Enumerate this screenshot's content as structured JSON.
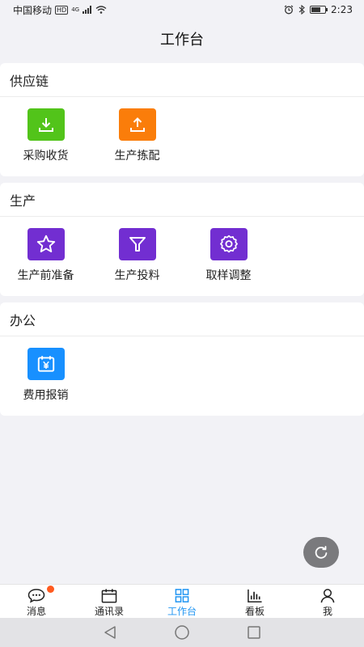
{
  "status_bar": {
    "carrier": "中国移动",
    "hd": "HD",
    "network": "4G",
    "time": "2:23",
    "battery_level": 0.7
  },
  "header": {
    "title": "工作台"
  },
  "sections": [
    {
      "title": "供应链",
      "items": [
        {
          "label": "采购收货",
          "icon": "download-icon",
          "color": "#52c41a"
        },
        {
          "label": "生产拣配",
          "icon": "upload-icon",
          "color": "#fa7d0a"
        }
      ]
    },
    {
      "title": "生产",
      "items": [
        {
          "label": "生产前准备",
          "icon": "star-icon",
          "color": "#722ed1"
        },
        {
          "label": "生产投料",
          "icon": "funnel-icon",
          "color": "#722ed1"
        },
        {
          "label": "取样调整",
          "icon": "gear-icon",
          "color": "#722ed1"
        }
      ]
    },
    {
      "title": "办公",
      "items": [
        {
          "label": "费用报销",
          "icon": "yen-calendar-icon",
          "color": "#1890ff"
        }
      ]
    }
  ],
  "tab_bar": {
    "active": "工作台",
    "active_color": "#2196f3",
    "items": [
      {
        "label": "消息",
        "icon": "message-icon",
        "has_badge": true
      },
      {
        "label": "通讯录",
        "icon": "contacts-calendar-icon"
      },
      {
        "label": "工作台",
        "icon": "grid-icon"
      },
      {
        "label": "看板",
        "icon": "bar-chart-icon"
      },
      {
        "label": "我",
        "icon": "person-icon"
      }
    ]
  }
}
